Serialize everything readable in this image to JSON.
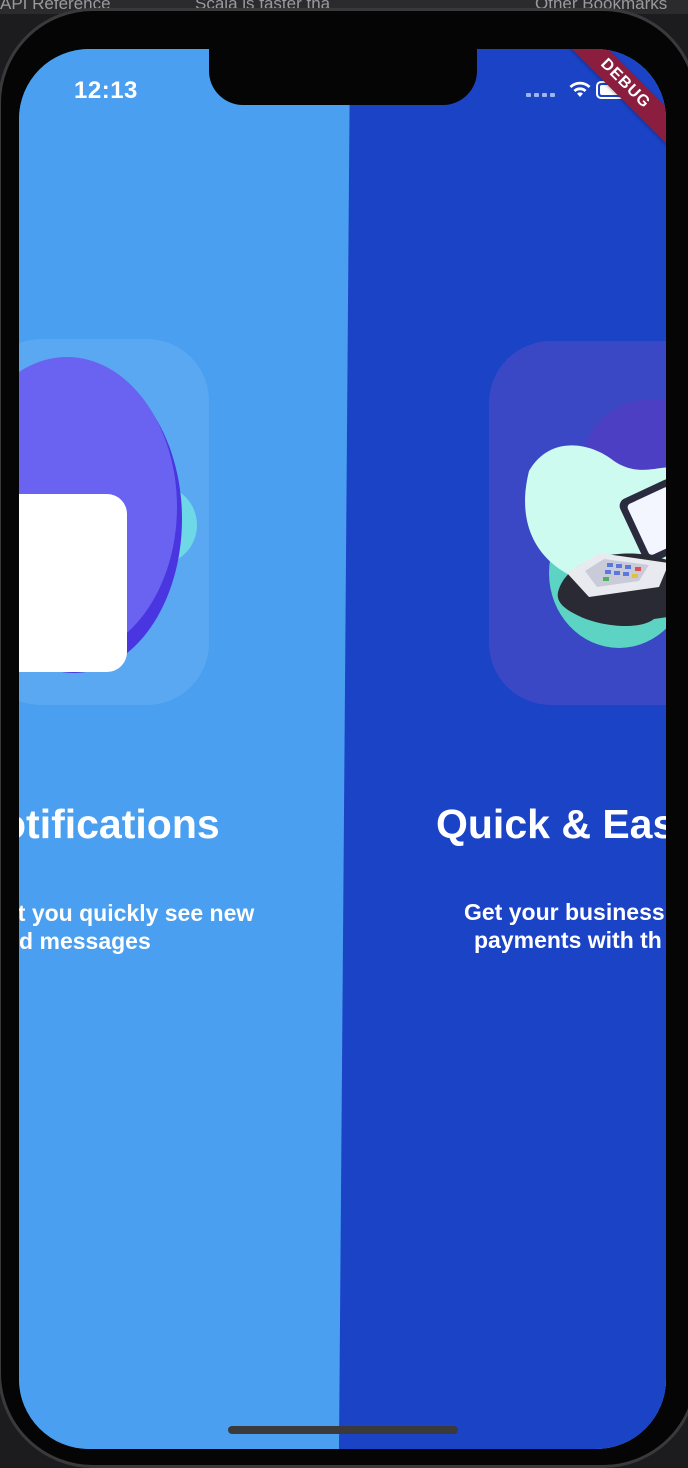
{
  "browser_tabs": [
    {
      "label": "API Reference"
    },
    {
      "label": "Scala is faster tha"
    },
    {
      "label": "Other Bookmarks"
    }
  ],
  "status_bar": {
    "time": "12:13",
    "debug_banner": "DEBUG"
  },
  "pages": {
    "left": {
      "title": "otifications",
      "description_line1": "et you quickly see new",
      "description_line2": "nd messages"
    },
    "right": {
      "title": "Quick & Eas",
      "description_line1": "Get your business",
      "description_line2": "payments with th"
    }
  },
  "colors": {
    "left_page_bg": "#4a9ff0",
    "right_page_bg": "#1b43c6",
    "debug_banner": "#8b1e3f"
  }
}
